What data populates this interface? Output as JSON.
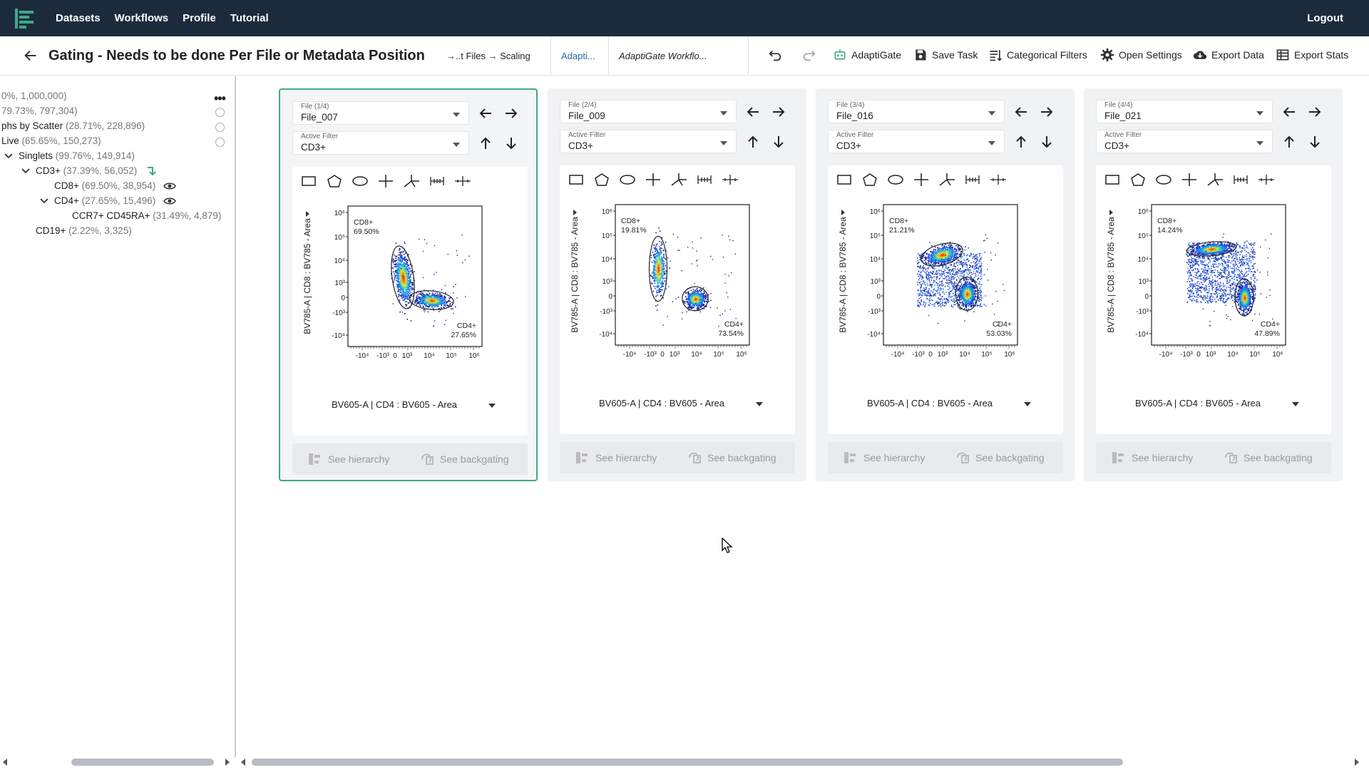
{
  "nav": {
    "items": [
      "Datasets",
      "Workflows",
      "Profile",
      "Tutorial"
    ],
    "logout": "Logout"
  },
  "subbar": {
    "title": "Gating - Needs to be done Per File or Metadata Position",
    "tabs": [
      "→..t Files → Scaling",
      "Adapti...",
      "AdaptiGate Workflo..."
    ],
    "buttons": [
      "AdaptiGate",
      "Save Task",
      "Categorical Filters",
      "Open Settings",
      "Export Data",
      "Export Stats"
    ]
  },
  "tree": {
    "rows": [
      {
        "name": "",
        "stat": "0%, 1,000,000)"
      },
      {
        "name": "",
        "stat": "79.73%, 797,304)"
      },
      {
        "name": "phs by Scatter",
        "stat": " (28.71%, 228,896)"
      },
      {
        "name": "Live",
        "stat": " (65.65%, 150,273)"
      },
      {
        "name": "Singlets",
        "stat": " (99.76%, 149,914)"
      },
      {
        "name": "CD3+",
        "stat": " (37.39%, 56,052)"
      },
      {
        "name": "CD8+",
        "stat": " (69.50%, 38,954)"
      },
      {
        "name": "CD4+",
        "stat": " (27.65%, 15,496)"
      },
      {
        "name": "CCR7+ CD45RA+",
        "stat": " (31.49%, 4,879)"
      },
      {
        "name": "CD19+",
        "stat": " (2.22%, 3,325)"
      }
    ],
    "menu": "•••"
  },
  "cards": [
    {
      "file_label": "File (1/4)",
      "file": "File_007",
      "filter_label": "Active Filter",
      "filter": "CD3+",
      "cd8": "CD8+",
      "cd8_pct": "69.50%",
      "cd4": "CD4+",
      "cd4_pct": "27.65%"
    },
    {
      "file_label": "File (2/4)",
      "file": "File_009",
      "filter_label": "Active Filter",
      "filter": "CD3+",
      "cd8": "CD8+",
      "cd8_pct": "19.81%",
      "cd4": "CD4+",
      "cd4_pct": "73.54%"
    },
    {
      "file_label": "File (3/4)",
      "file": "File_016",
      "filter_label": "Active Filter",
      "filter": "CD3+",
      "cd8": "CD8+",
      "cd8_pct": "21.21%",
      "cd4": "CD4+",
      "cd4_pct": "53.03%"
    },
    {
      "file_label": "File (4/4)",
      "file": "File_021",
      "filter_label": "Active Filter",
      "filter": "CD3+",
      "cd8": "CD8+",
      "cd8_pct": "14.24%",
      "cd4": "CD4+",
      "cd4_pct": "47.89%"
    }
  ],
  "plot": {
    "xlabel": "BV605-A | CD4 : BV605 - Area",
    "ylabel": "BV785-A | CD8 : BV785 - Area",
    "yticks": [
      "10⁶",
      "10⁵",
      "10⁴",
      "10³",
      "0",
      "-10³",
      "-10⁴"
    ],
    "xticks": [
      "-10⁴",
      "-10³",
      "0",
      "10³",
      "10⁴",
      "10⁵",
      "10⁶"
    ]
  },
  "buttons": {
    "hierarchy": "See hierarchy",
    "backgating": "See backgating"
  }
}
